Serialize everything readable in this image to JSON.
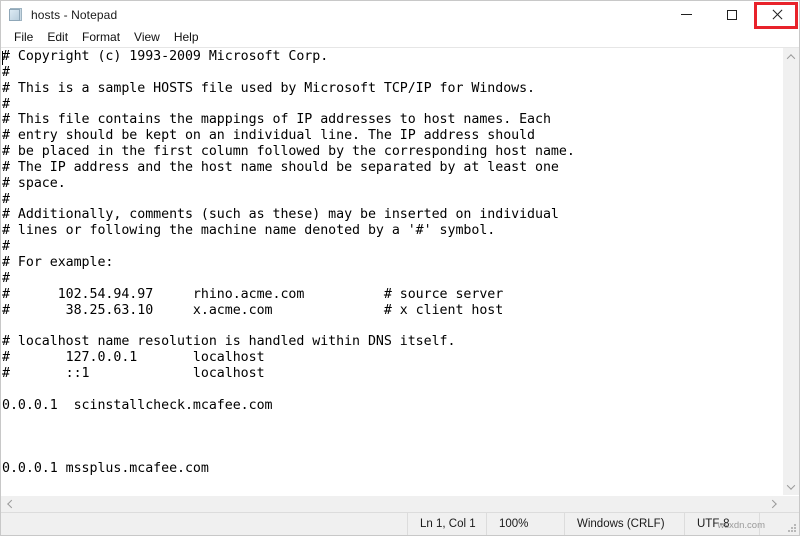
{
  "window": {
    "title": "hosts - Notepad",
    "icon": "notepad-icon"
  },
  "caption": {
    "minimize_label": "Minimize",
    "maximize_label": "Maximize",
    "close_label": "Close",
    "highlight_color": "#e8222a"
  },
  "menu": {
    "items": [
      {
        "label": "File"
      },
      {
        "label": "Edit"
      },
      {
        "label": "Format"
      },
      {
        "label": "View"
      },
      {
        "label": "Help"
      }
    ]
  },
  "editor": {
    "text": "# Copyright (c) 1993-2009 Microsoft Corp.\n#\n# This is a sample HOSTS file used by Microsoft TCP/IP for Windows.\n#\n# This file contains the mappings of IP addresses to host names. Each\n# entry should be kept on an individual line. The IP address should\n# be placed in the first column followed by the corresponding host name.\n# The IP address and the host name should be separated by at least one\n# space.\n#\n# Additionally, comments (such as these) may be inserted on individual\n# lines or following the machine name denoted by a '#' symbol.\n#\n# For example:\n#\n#      102.54.94.97     rhino.acme.com          # source server\n#       38.25.63.10     x.acme.com              # x client host\n\n# localhost name resolution is handled within DNS itself.\n#       127.0.0.1       localhost\n#       ::1             localhost\n\n0.0.0.1  scinstallcheck.mcafee.com\n\n\n\n0.0.0.1 mssplus.mcafee.com"
  },
  "scrollbars": {
    "vertical_up": "chevron-up-icon",
    "vertical_down": "chevron-down-icon",
    "horizontal_left": "chevron-left-icon",
    "horizontal_right": "chevron-right-icon"
  },
  "statusbar": {
    "position": "Ln 1, Col 1",
    "zoom": "100%",
    "line_ending": "Windows (CRLF)",
    "encoding": "UTF-8",
    "watermark": "wsxdn.com"
  }
}
